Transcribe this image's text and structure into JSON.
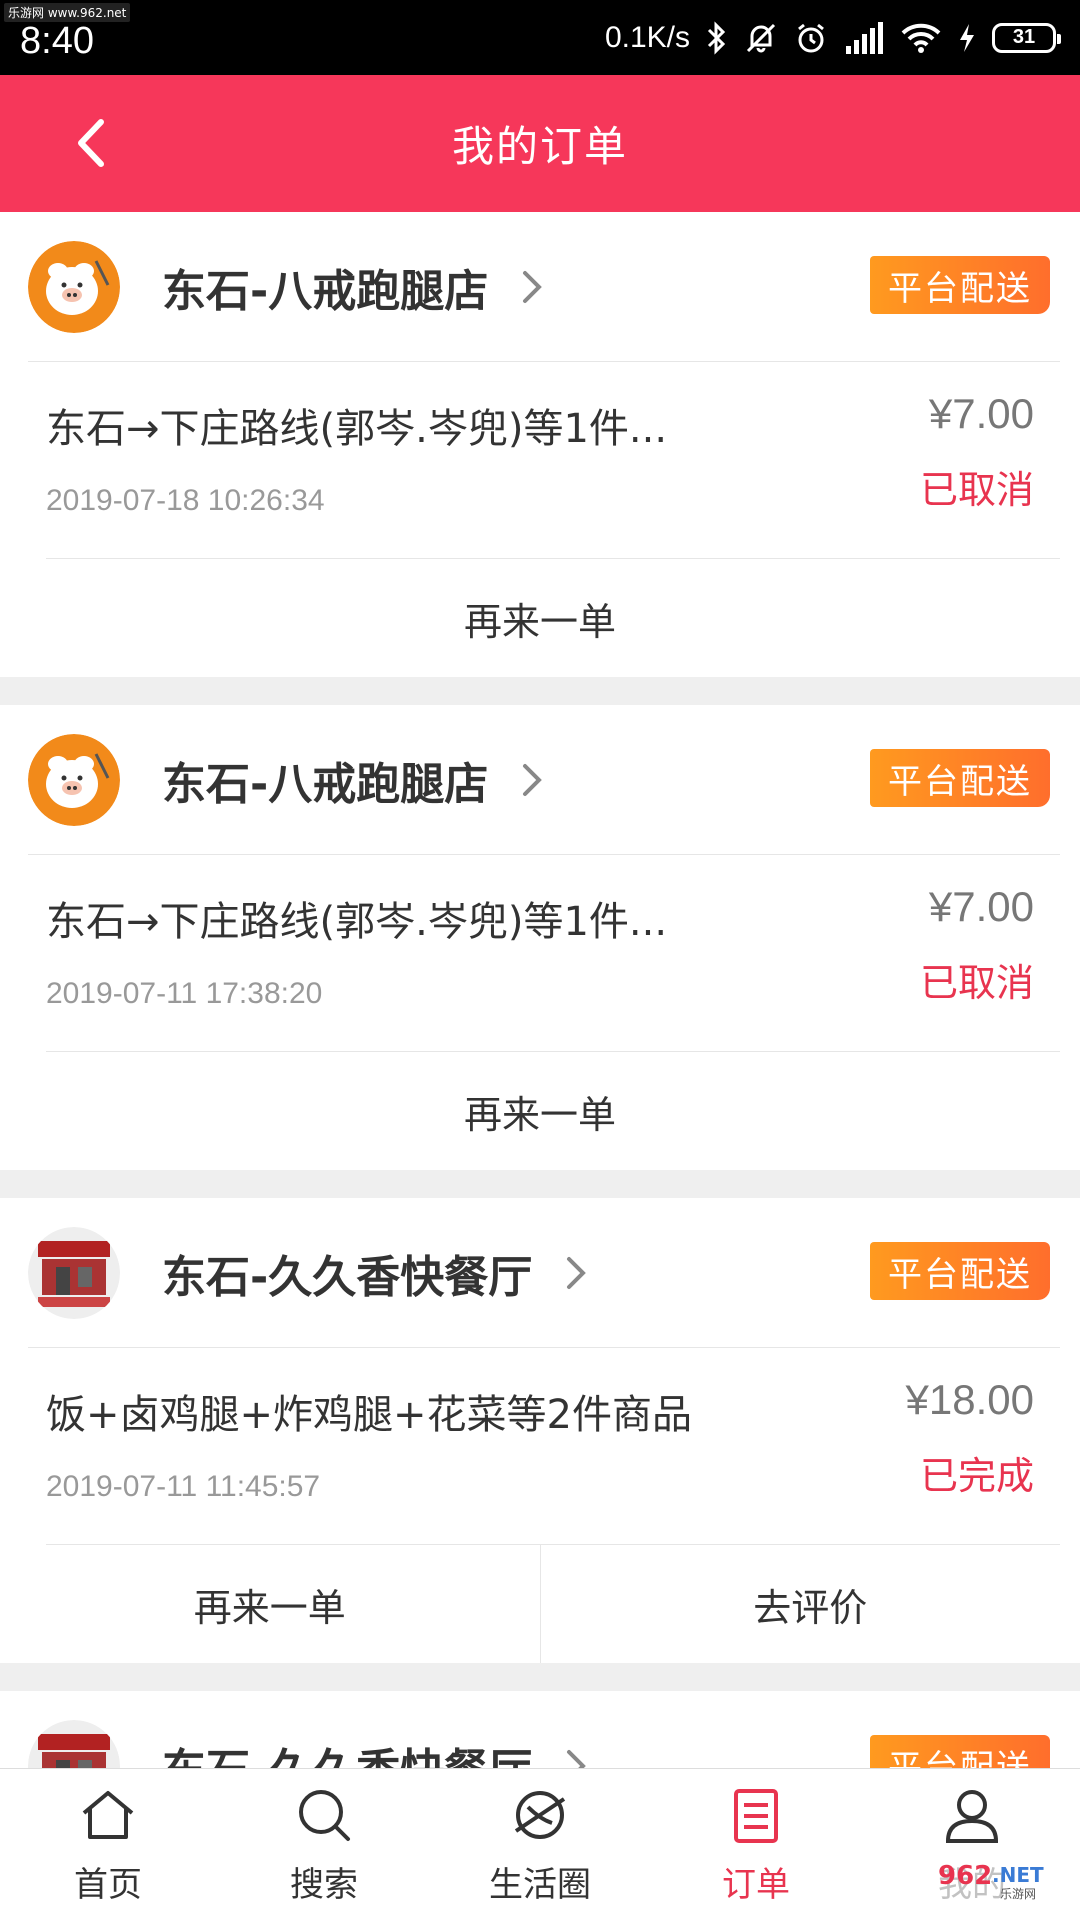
{
  "status_bar": {
    "watermark": "乐游网 www.962.net",
    "time": "8:40",
    "network_speed": "0.1K/s",
    "battery": "31"
  },
  "header": {
    "title": "我的订单"
  },
  "orders": [
    {
      "shop_name": "东石-八戒跑腿店",
      "badge": "平台配送",
      "item": "东石→下庄路线(郭岑.岑兜)等1件...",
      "date": "2019-07-18 10:26:34",
      "price": "¥7.00",
      "status": "已取消",
      "actions": [
        "再来一单"
      ]
    },
    {
      "shop_name": "东石-八戒跑腿店",
      "badge": "平台配送",
      "item": "东石→下庄路线(郭岑.岑兜)等1件...",
      "date": "2019-07-11 17:38:20",
      "price": "¥7.00",
      "status": "已取消",
      "actions": [
        "再来一单"
      ]
    },
    {
      "shop_name": "东石-久久香快餐厅",
      "badge": "平台配送",
      "item": "饭+卤鸡腿+炸鸡腿+花菜等2件商品",
      "date": "2019-07-11 11:45:57",
      "price": "¥18.00",
      "status": "已完成",
      "actions": [
        "再来一单",
        "去评价"
      ]
    },
    {
      "shop_name": "东石-久久香快餐厅",
      "badge": "平台配送"
    }
  ],
  "bottom_nav": {
    "items": [
      {
        "label": "首页",
        "icon": "home-icon"
      },
      {
        "label": "搜索",
        "icon": "search-icon"
      },
      {
        "label": "生活圈",
        "icon": "planet-icon"
      },
      {
        "label": "订单",
        "icon": "orders-icon",
        "active": true
      },
      {
        "label": "我的",
        "icon": "user-icon"
      }
    ]
  },
  "watermark_br": "962.NET 乐游网",
  "colors": {
    "header": "#f6375a",
    "status_red": "#e8344f",
    "badge_orange": "#ff7f26"
  }
}
